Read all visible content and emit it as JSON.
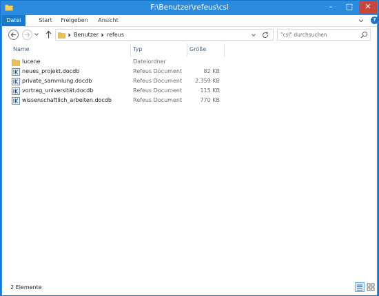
{
  "window": {
    "title": "F:\\Benutzer\\refeus\\csl",
    "minimize_label": "–",
    "maximize_label": "□",
    "close_label": "✕"
  },
  "ribbon": {
    "tabs": [
      "Datei",
      "Start",
      "Freigeben",
      "Ansicht"
    ],
    "help_label": "?"
  },
  "navigation": {
    "breadcrumb": [
      "Benutzer",
      "refeus"
    ],
    "search_placeholder": "\"csl\" durchsuchen"
  },
  "columns": {
    "name": "Name",
    "type": "Typ",
    "size": "Größe"
  },
  "files": [
    {
      "icon": "folder-icon",
      "name": "lucene",
      "type": "Dateiordner",
      "size": ""
    },
    {
      "icon": "refeus-document-icon",
      "name": "neues_projekt.docdb",
      "type": "Refeus Document",
      "size": "82 KB"
    },
    {
      "icon": "refeus-document-icon",
      "name": "private_sammlung.docdb",
      "type": "Refeus Document",
      "size": "2.359 KB"
    },
    {
      "icon": "refeus-document-icon",
      "name": "vortrag_universität.docdb",
      "type": "Refeus Document",
      "size": "115 KB"
    },
    {
      "icon": "refeus-document-icon",
      "name": "wissenschaftlich_arbeiten.docdb",
      "type": "Refeus Document",
      "size": "770 KB"
    }
  ],
  "status": {
    "item_count": "2 Elemente"
  },
  "colors": {
    "titlebar": "#2b8cdf",
    "datei_tab": "#1979ca",
    "close_button": "#c7473a",
    "folder": "#e8c15f",
    "header_text": "#4c607a"
  }
}
